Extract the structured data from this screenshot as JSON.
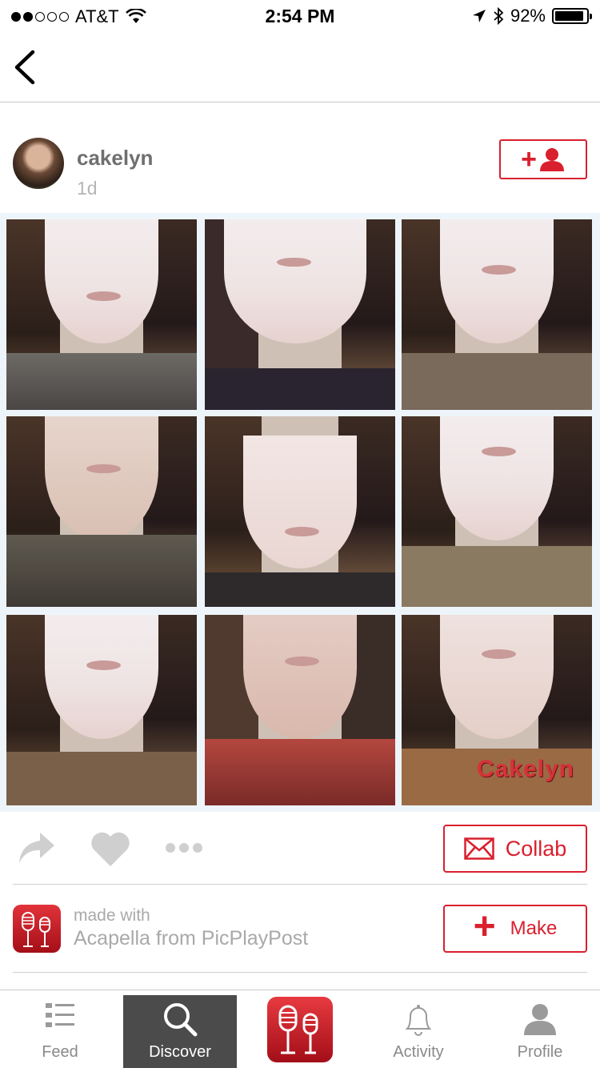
{
  "status_bar": {
    "carrier": "AT&T",
    "signal_bars_filled": 2,
    "signal_bars_total": 5,
    "time": "2:54 PM",
    "battery": "92%",
    "battery_level": 0.92
  },
  "post": {
    "username": "cakelyn",
    "age": "1d",
    "watermark": "Cakelyn"
  },
  "actions": {
    "collab_label": "Collab"
  },
  "made_with": {
    "label": "made with",
    "app": "Acapella from PicPlayPost",
    "make_label": "Make"
  },
  "tabs": [
    {
      "label": "Feed"
    },
    {
      "label": "Discover"
    },
    {
      "label": "Activity"
    },
    {
      "label": "Profile"
    }
  ],
  "colors": {
    "accent": "#d9202e",
    "active_tab_bg": "#4b4b4b",
    "muted_text": "#a9a9a9"
  }
}
